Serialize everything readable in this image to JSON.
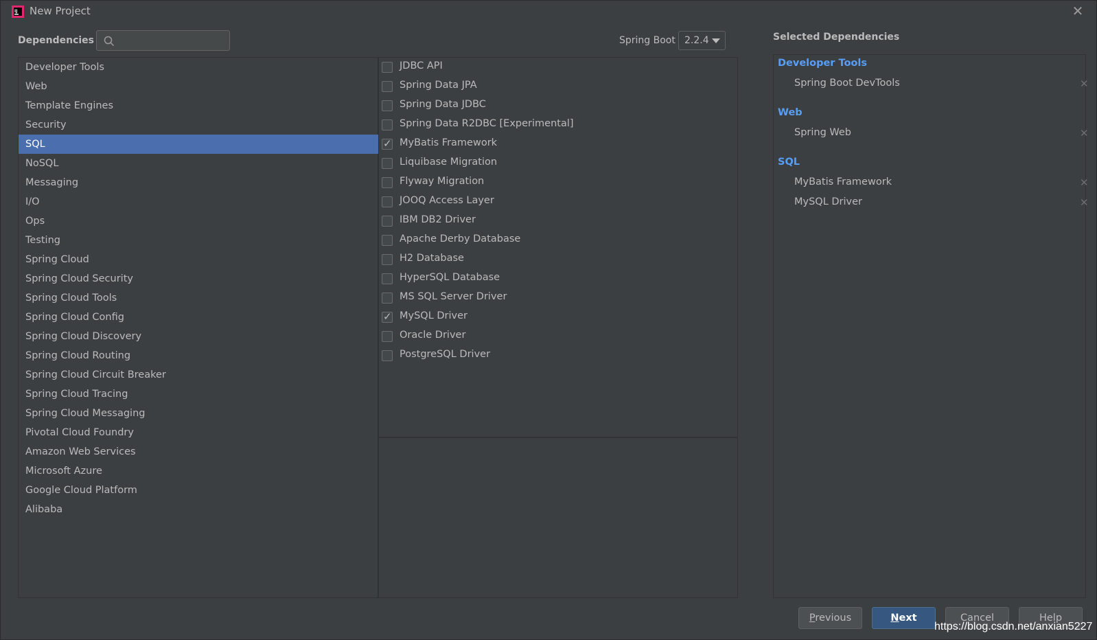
{
  "window": {
    "title": "New Project"
  },
  "header": {
    "dependencies_label": "Dependencies",
    "search_placeholder": "",
    "spring_boot_label": "Spring Boot",
    "spring_boot_version": "2.2.4"
  },
  "categories": [
    {
      "label": "Developer Tools"
    },
    {
      "label": "Web"
    },
    {
      "label": "Template Engines"
    },
    {
      "label": "Security"
    },
    {
      "label": "SQL",
      "selected": true
    },
    {
      "label": "NoSQL"
    },
    {
      "label": "Messaging"
    },
    {
      "label": "I/O"
    },
    {
      "label": "Ops"
    },
    {
      "label": "Testing"
    },
    {
      "label": "Spring Cloud"
    },
    {
      "label": "Spring Cloud Security"
    },
    {
      "label": "Spring Cloud Tools"
    },
    {
      "label": "Spring Cloud Config"
    },
    {
      "label": "Spring Cloud Discovery"
    },
    {
      "label": "Spring Cloud Routing"
    },
    {
      "label": "Spring Cloud Circuit Breaker"
    },
    {
      "label": "Spring Cloud Tracing"
    },
    {
      "label": "Spring Cloud Messaging"
    },
    {
      "label": "Pivotal Cloud Foundry"
    },
    {
      "label": "Amazon Web Services"
    },
    {
      "label": "Microsoft Azure"
    },
    {
      "label": "Google Cloud Platform"
    },
    {
      "label": "Alibaba"
    }
  ],
  "dependencies": [
    {
      "label": "JDBC API",
      "checked": false
    },
    {
      "label": "Spring Data JPA",
      "checked": false
    },
    {
      "label": "Spring Data JDBC",
      "checked": false
    },
    {
      "label": "Spring Data R2DBC [Experimental]",
      "checked": false
    },
    {
      "label": "MyBatis Framework",
      "checked": true
    },
    {
      "label": "Liquibase Migration",
      "checked": false
    },
    {
      "label": "Flyway Migration",
      "checked": false
    },
    {
      "label": "JOOQ Access Layer",
      "checked": false
    },
    {
      "label": "IBM DB2 Driver",
      "checked": false
    },
    {
      "label": "Apache Derby Database",
      "checked": false
    },
    {
      "label": "H2 Database",
      "checked": false
    },
    {
      "label": "HyperSQL Database",
      "checked": false
    },
    {
      "label": "MS SQL Server Driver",
      "checked": false
    },
    {
      "label": "MySQL Driver",
      "checked": true
    },
    {
      "label": "Oracle Driver",
      "checked": false
    },
    {
      "label": "PostgreSQL Driver",
      "checked": false
    }
  ],
  "selected": {
    "title": "Selected Dependencies",
    "groups": [
      {
        "name": "Developer Tools",
        "items": [
          "Spring Boot DevTools"
        ]
      },
      {
        "name": "Web",
        "items": [
          "Spring Web"
        ]
      },
      {
        "name": "SQL",
        "items": [
          "MyBatis Framework",
          "MySQL Driver"
        ]
      }
    ]
  },
  "buttons": {
    "previous": {
      "mnemonic": "P",
      "rest": "revious"
    },
    "next": {
      "mnemonic": "N",
      "rest": "ext"
    },
    "cancel": "Cancel",
    "help": "Help"
  },
  "colors": {
    "accent_selection": "#4b6eaf",
    "group_title": "#589df6",
    "primary_button": "#365880"
  },
  "watermark": "https://blog.csdn.net/anxian5227"
}
